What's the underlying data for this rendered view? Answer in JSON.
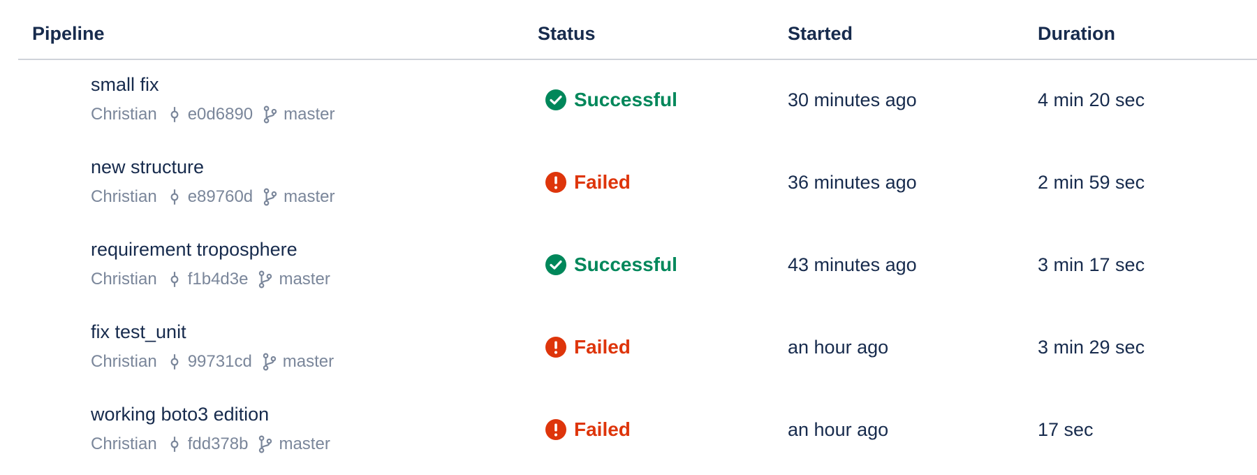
{
  "columns": {
    "pipeline": "Pipeline",
    "status": "Status",
    "started": "Started",
    "duration": "Duration"
  },
  "colors": {
    "success": "#00875a",
    "failed": "#de350b",
    "text": "#172b4d",
    "muted": "#7a869a"
  },
  "rows": [
    {
      "title": "small fix",
      "author": "Christian",
      "commit": "e0d6890",
      "branch": "master",
      "status": "Successful",
      "status_type": "success",
      "started": "30 minutes ago",
      "duration": "4 min 20 sec"
    },
    {
      "title": "new structure",
      "author": "Christian",
      "commit": "e89760d",
      "branch": "master",
      "status": "Failed",
      "status_type": "failed",
      "started": "36 minutes ago",
      "duration": "2 min 59 sec"
    },
    {
      "title": "requirement troposphere",
      "author": "Christian",
      "commit": "f1b4d3e",
      "branch": "master",
      "status": "Successful",
      "status_type": "success",
      "started": "43 minutes ago",
      "duration": "3 min 17 sec"
    },
    {
      "title": "fix test_unit",
      "author": "Christian",
      "commit": "99731cd",
      "branch": "master",
      "status": "Failed",
      "status_type": "failed",
      "started": "an hour ago",
      "duration": "3 min 29 sec"
    },
    {
      "title": "working boto3 edition",
      "author": "Christian",
      "commit": "fdd378b",
      "branch": "master",
      "status": "Failed",
      "status_type": "failed",
      "started": "an hour ago",
      "duration": "17 sec"
    }
  ]
}
